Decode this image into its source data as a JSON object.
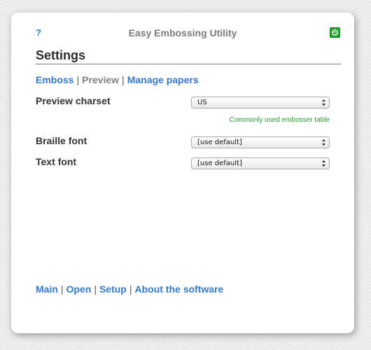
{
  "header": {
    "help_label": "?",
    "app_title": "Easy Embossing Utility",
    "power_icon": "power-icon",
    "power_color": "#21a52b"
  },
  "page": {
    "title": "Settings"
  },
  "tabs": [
    {
      "label": "Emboss",
      "active": false
    },
    {
      "label": "Preview",
      "active": true
    },
    {
      "label": "Manage papers",
      "active": false
    }
  ],
  "tab_separator": "|",
  "settings": {
    "preview_charset": {
      "label": "Preview charset",
      "value": "US",
      "hint": "Commonly used embosser table"
    },
    "braille_font": {
      "label": "Braille font",
      "value": "[use default]"
    },
    "text_font": {
      "label": "Text font",
      "value": "[use default]"
    }
  },
  "bottom_nav": [
    {
      "label": "Main"
    },
    {
      "label": "Open"
    },
    {
      "label": "Setup"
    },
    {
      "label": "About the software"
    }
  ],
  "colors": {
    "link": "#3478c8",
    "active_tab": "#808080",
    "hint": "#2d9a2d"
  }
}
